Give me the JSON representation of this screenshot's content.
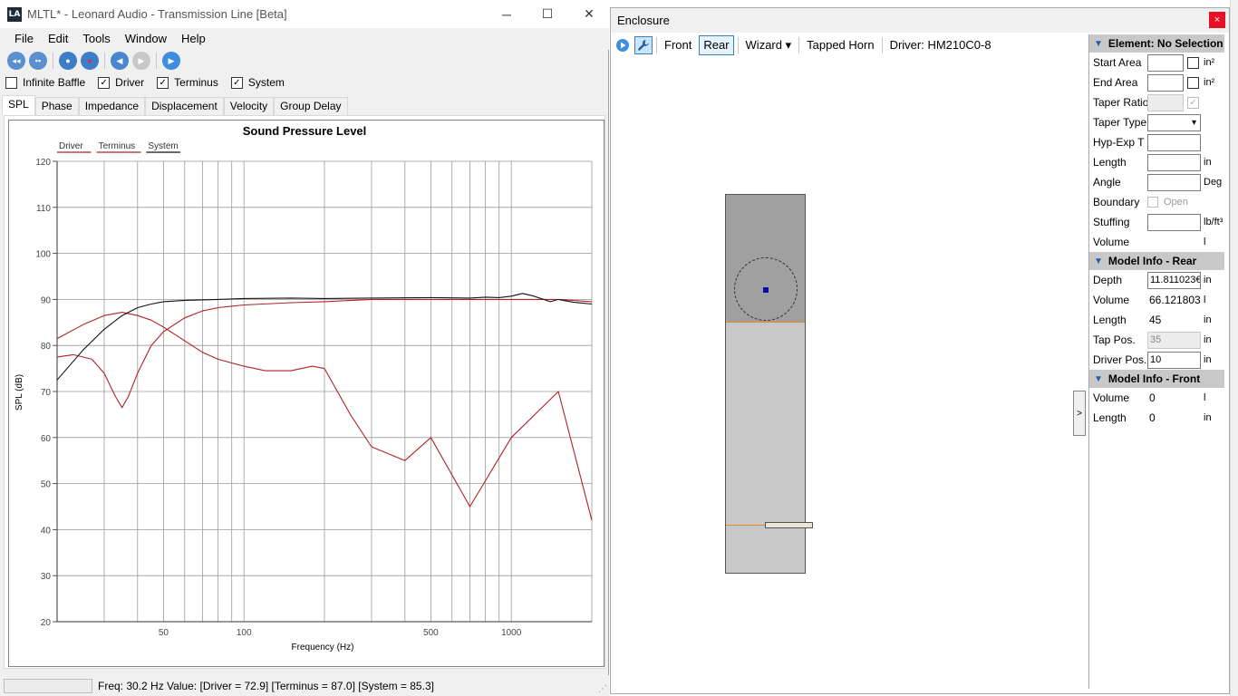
{
  "main_window": {
    "title": "MLTL* - Leonard Audio - Transmission Line [Beta]",
    "logo_text": "LA",
    "controls": {
      "minimize": "─",
      "maximize": "☐",
      "close": "✕"
    }
  },
  "menu": [
    "File",
    "Edit",
    "Tools",
    "Window",
    "Help"
  ],
  "toolbar_icons": [
    "open-icon",
    "save-icon",
    "record-blue-icon",
    "record-red-icon",
    "step-back-icon",
    "step-forward-icon",
    "play-icon"
  ],
  "options": [
    {
      "label": "Infinite Baffle",
      "checked": false
    },
    {
      "label": "Driver",
      "checked": true
    },
    {
      "label": "Terminus",
      "checked": true
    },
    {
      "label": "System",
      "checked": true
    }
  ],
  "tabs": [
    "SPL",
    "Phase",
    "Impedance",
    "Displacement",
    "Velocity",
    "Group Delay"
  ],
  "active_tab": "SPL",
  "chart_data": {
    "type": "line",
    "title": "Sound Pressure Level",
    "xlabel": "Frequency (Hz)",
    "ylabel": "SPL (dB)",
    "x_scale": "log",
    "xlim": [
      20,
      2000
    ],
    "ylim": [
      20,
      120
    ],
    "x_tick_labels": [
      "50",
      "100",
      "500",
      "1000"
    ],
    "y_tick_labels": [
      "20",
      "30",
      "40",
      "50",
      "60",
      "70",
      "80",
      "90",
      "100",
      "110",
      "120"
    ],
    "legend": [
      "Driver",
      "Terminus",
      "System"
    ],
    "legend_placement": "top-left",
    "grid": true,
    "series": [
      {
        "name": "Driver",
        "color": "#b22222",
        "x": [
          20,
          25,
          30,
          35,
          40,
          45,
          50,
          60,
          70,
          80,
          100,
          120,
          150,
          180,
          200,
          250,
          300,
          400,
          500,
          700,
          1000,
          1500,
          2000
        ],
        "y": [
          81.5,
          84.5,
          86.5,
          87.2,
          86.5,
          85.5,
          84,
          81,
          78.5,
          77,
          75.5,
          74.5,
          74.5,
          75.5,
          75,
          65,
          58,
          55,
          60,
          45,
          60,
          70,
          42
        ]
      },
      {
        "name": "Terminus",
        "color": "#b22222",
        "x": [
          20,
          23,
          27,
          30,
          33,
          35,
          37,
          40,
          45,
          50,
          60,
          70,
          80,
          100,
          150,
          200,
          300,
          500,
          700,
          1000,
          1500,
          2000
        ],
        "y": [
          77.5,
          78,
          77,
          74,
          69,
          66.5,
          69,
          74,
          80,
          83,
          86,
          87.5,
          88.2,
          88.8,
          89.3,
          89.5,
          90,
          90,
          90,
          90,
          90,
          89.5
        ]
      },
      {
        "name": "System",
        "color": "#111111",
        "x": [
          20,
          25,
          30,
          35,
          40,
          45,
          50,
          60,
          70,
          80,
          100,
          150,
          200,
          300,
          500,
          700,
          800,
          900,
          1000,
          1100,
          1200,
          1400,
          1500,
          1700,
          2000
        ],
        "y": [
          72.5,
          79,
          83.5,
          86.5,
          88.2,
          89,
          89.5,
          89.8,
          89.9,
          90,
          90.2,
          90.3,
          90.2,
          90.3,
          90.4,
          90.3,
          90.5,
          90.4,
          90.7,
          91.3,
          90.8,
          89.5,
          90,
          89.4,
          89
        ]
      }
    ]
  },
  "status": {
    "text": "Freq: 30.2 Hz  Value: [Driver = 72.9]  [Terminus = 87.0]  [System = 85.3]"
  },
  "enclosure": {
    "title": "Enclosure",
    "close": "×",
    "toolbar": {
      "front": "Front",
      "rear": "Rear",
      "wizard": "Wizard ▾",
      "tapped_horn": "Tapped Horn",
      "driver": "Driver: HM210C0-8"
    },
    "toggle": ">",
    "element_section": {
      "title": "Element: No Selection",
      "rows": [
        {
          "label": "Start Area",
          "unit": "in²"
        },
        {
          "label": "End Area",
          "unit": "in²"
        },
        {
          "label": "Taper Ratio",
          "unit": ""
        },
        {
          "label": "Taper Type",
          "unit": ""
        },
        {
          "label": "Hyp-Exp T",
          "unit": ""
        },
        {
          "label": "Length",
          "unit": "in"
        },
        {
          "label": "Angle",
          "unit": "Deg"
        },
        {
          "label": "Boundary",
          "unit": "",
          "option": "Open"
        },
        {
          "label": "Stuffing",
          "unit": "lb/ft³"
        },
        {
          "label": "Volume",
          "unit": "l"
        }
      ]
    },
    "rear_section": {
      "title": "Model Info - Rear",
      "depth": {
        "label": "Depth",
        "value": "11.811023€",
        "unit": "in"
      },
      "volume": {
        "label": "Volume",
        "value": "66.121803",
        "unit": "l"
      },
      "length": {
        "label": "Length",
        "value": "45",
        "unit": "in"
      },
      "tap_pos": {
        "label": "Tap Pos.",
        "value": "35",
        "unit": "in"
      },
      "driver_pos": {
        "label": "Driver Pos.",
        "value": "10",
        "unit": "in"
      }
    },
    "front_section": {
      "title": "Model Info - Front",
      "volume": {
        "label": "Volume",
        "value": "0",
        "unit": "l"
      },
      "length": {
        "label": "Length",
        "value": "0",
        "unit": "in"
      }
    }
  }
}
